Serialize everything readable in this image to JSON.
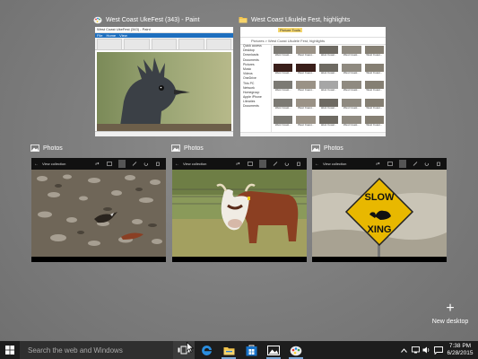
{
  "windows": {
    "paint": {
      "title": "West Coast UkeFest (343) - Paint",
      "icon": "paint-palette-icon",
      "tabs": [
        "File",
        "Home",
        "View"
      ],
      "window_title": "West Coast UkeFest (343) - Paint"
    },
    "explorer": {
      "title": "West Coast Ukulele Fest, highlights",
      "icon": "folder-icon",
      "manage_label": "Picture Tools",
      "address": "Pictures > West Coast Ukulele Fest, highlights",
      "nav_items": [
        "Quick access",
        "Desktop",
        "Downloads",
        "Documents",
        "Pictures",
        "Music",
        "Videos",
        "OneDrive",
        "This PC",
        "Network",
        "Homegroup",
        "Apple iPhone",
        "Libraries",
        "Documents"
      ],
      "items": [
        "West Coast...",
        "West Coast...",
        "West Coast...",
        "West Coast...",
        "West Coast...",
        "West Coast...",
        "West Coast...",
        "West Coast...",
        "West Coast...",
        "West Coast...",
        "West Coast...",
        "West Coast...",
        "West Coast...",
        "West Coast...",
        "West Coast...",
        "West Coast...",
        "West Coast...",
        "West Coast...",
        "West Coast...",
        "West Coast...",
        "West Coast...",
        "West Coast...",
        "West Coast...",
        "West Coast...",
        "West Coast..."
      ]
    },
    "photos1": {
      "title": "Photos",
      "bar_label": "View collection",
      "icon": "photos-icon"
    },
    "photos2": {
      "title": "Photos",
      "bar_label": "View collection",
      "icon": "photos-icon"
    },
    "photos3": {
      "title": "Photos",
      "bar_label": "View collection",
      "icon": "photos-icon"
    }
  },
  "new_desktop": {
    "label": "New desktop",
    "icon": "plus-icon"
  },
  "taskbar": {
    "search_placeholder": "Search the web and Windows",
    "apps": [
      "task-view-icon",
      "edge-icon",
      "file-explorer-icon",
      "store-icon",
      "photos-icon",
      "paint-icon"
    ],
    "time": "7:38 PM",
    "date": "6/28/2015"
  },
  "colors": {
    "taskbar": "#1d1d1d",
    "accent": "#1e6fbf",
    "sign_yellow": "#e8b800"
  }
}
